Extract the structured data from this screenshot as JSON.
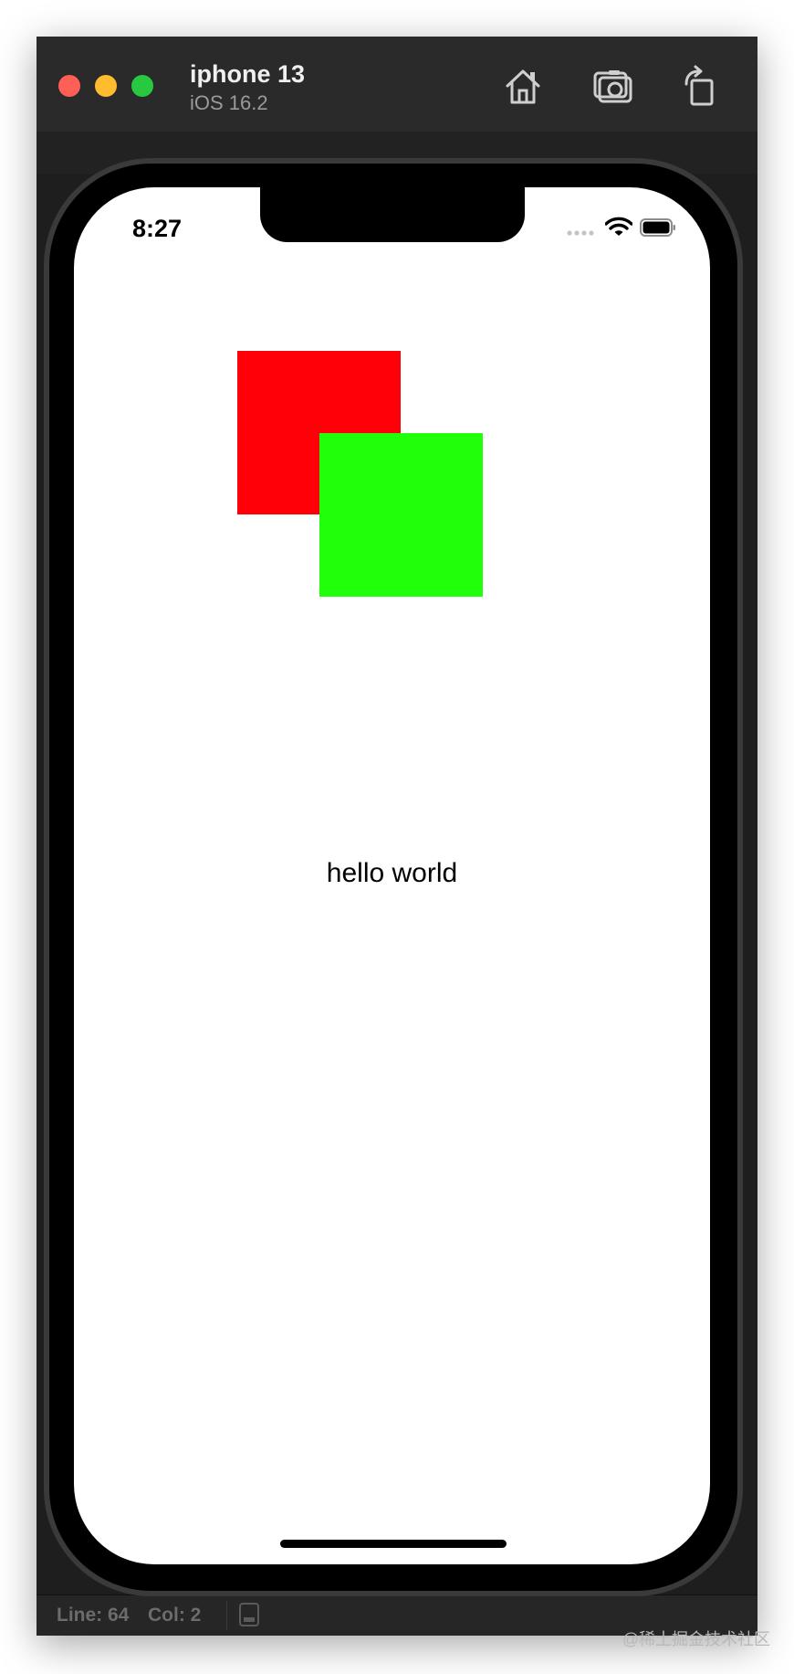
{
  "window": {
    "device_name": "iphone 13",
    "os_version": "iOS 16.2"
  },
  "toolbar": {
    "home_icon": "home-icon",
    "screenshot_icon": "camera-icon",
    "rotate_icon": "rotate-icon"
  },
  "statusbar": {
    "line": "Line: 64",
    "col": "Col: 2"
  },
  "phone": {
    "time": "8:27",
    "colors": {
      "red_square": "#ff0008",
      "green_square": "#22ff0a"
    },
    "label": "hello world"
  },
  "watermark": "@稀土掘金技术社区"
}
